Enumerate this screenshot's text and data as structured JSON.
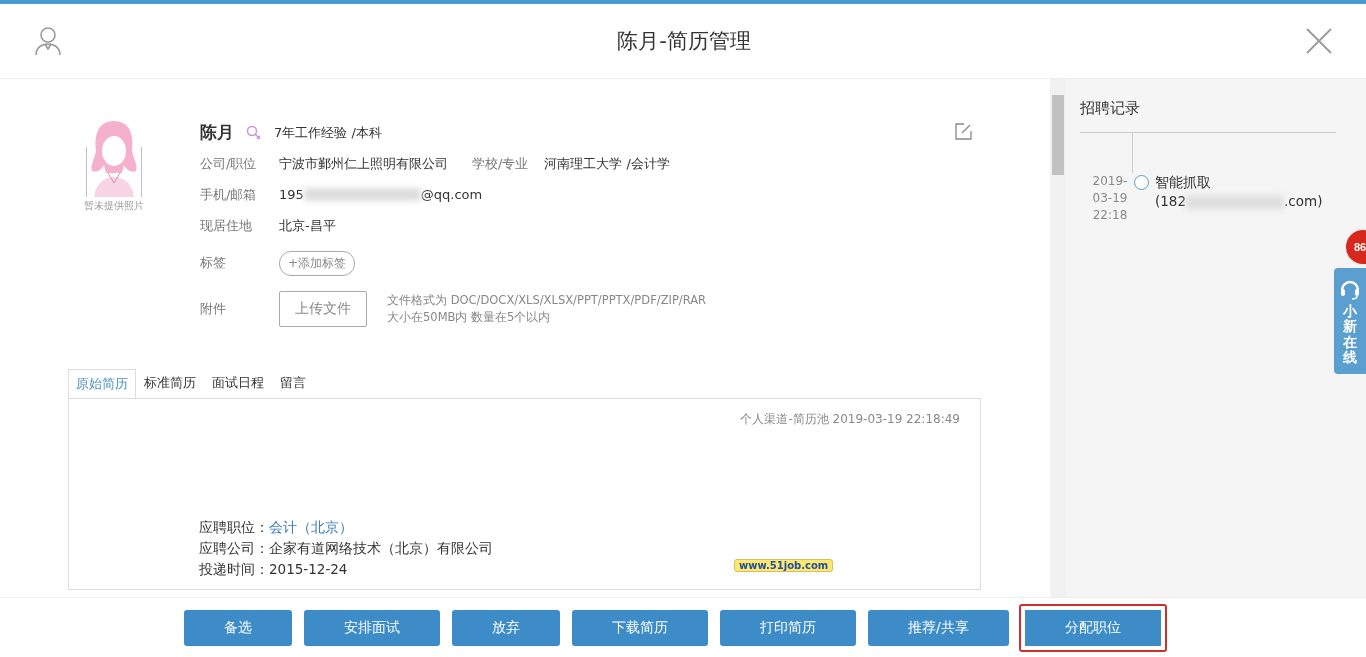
{
  "window": {
    "title": "陈月-简历管理"
  },
  "profile": {
    "name": "陈月",
    "summary": "7年工作经验 /本科",
    "photo_caption": "暂未提供照片",
    "company": {
      "label": "公司/职位",
      "value": "宁波市鄞州仁上照明有限公司"
    },
    "school": {
      "label": "学校/专业",
      "value": "河南理工大学 /会计学"
    },
    "contact": {
      "label": "手机/邮箱",
      "prefix": "195",
      "suffix": "@qq.com"
    },
    "residence": {
      "label": "现居住地",
      "value": "北京-昌平"
    },
    "tags": {
      "label": "标签",
      "button": "+添加标签"
    },
    "attachment": {
      "label": "附件",
      "button": "上传文件",
      "hints": [
        "文件格式为 DOC/DOCX/XLS/XLSX/PPT/PPTX/PDF/ZIP/RAR",
        "大小在50MB内 数量在5个以内"
      ]
    }
  },
  "resume_tabs": [
    {
      "label": "原始简历",
      "selected": true
    },
    {
      "label": "标准简历",
      "selected": false
    },
    {
      "label": "面试日程",
      "selected": false
    },
    {
      "label": "留言",
      "selected": false
    }
  ],
  "resume": {
    "source": "个人渠道-简历池 2019-03-19 22:18:49",
    "logo_text": "www.51job.com",
    "lines": [
      {
        "label": "应聘职位：",
        "value": "会计（北京）",
        "kind": "link"
      },
      {
        "label": "应聘公司：",
        "value": "企家有道网络技术（北京）有限公司",
        "kind": "text"
      },
      {
        "label": "投递时间：",
        "value": "2015-12-24",
        "kind": "text"
      }
    ]
  },
  "records": {
    "title": "招聘记录",
    "items": [
      {
        "date": "2019-03-19 22:18",
        "source": "智能抓取",
        "prefix": "(182",
        "suffix": ".com)"
      }
    ]
  },
  "actions": [
    {
      "label": "备选",
      "highlighted": false
    },
    {
      "label": "安排面试",
      "highlighted": false
    },
    {
      "label": "放弃",
      "highlighted": false
    },
    {
      "label": "下载简历",
      "highlighted": false
    },
    {
      "label": "打印简历",
      "highlighted": false
    },
    {
      "label": "推荐/共享",
      "highlighted": false
    },
    {
      "label": "分配职位",
      "highlighted": true
    }
  ],
  "float_widget": {
    "badge": "86",
    "label": "小新在线"
  }
}
